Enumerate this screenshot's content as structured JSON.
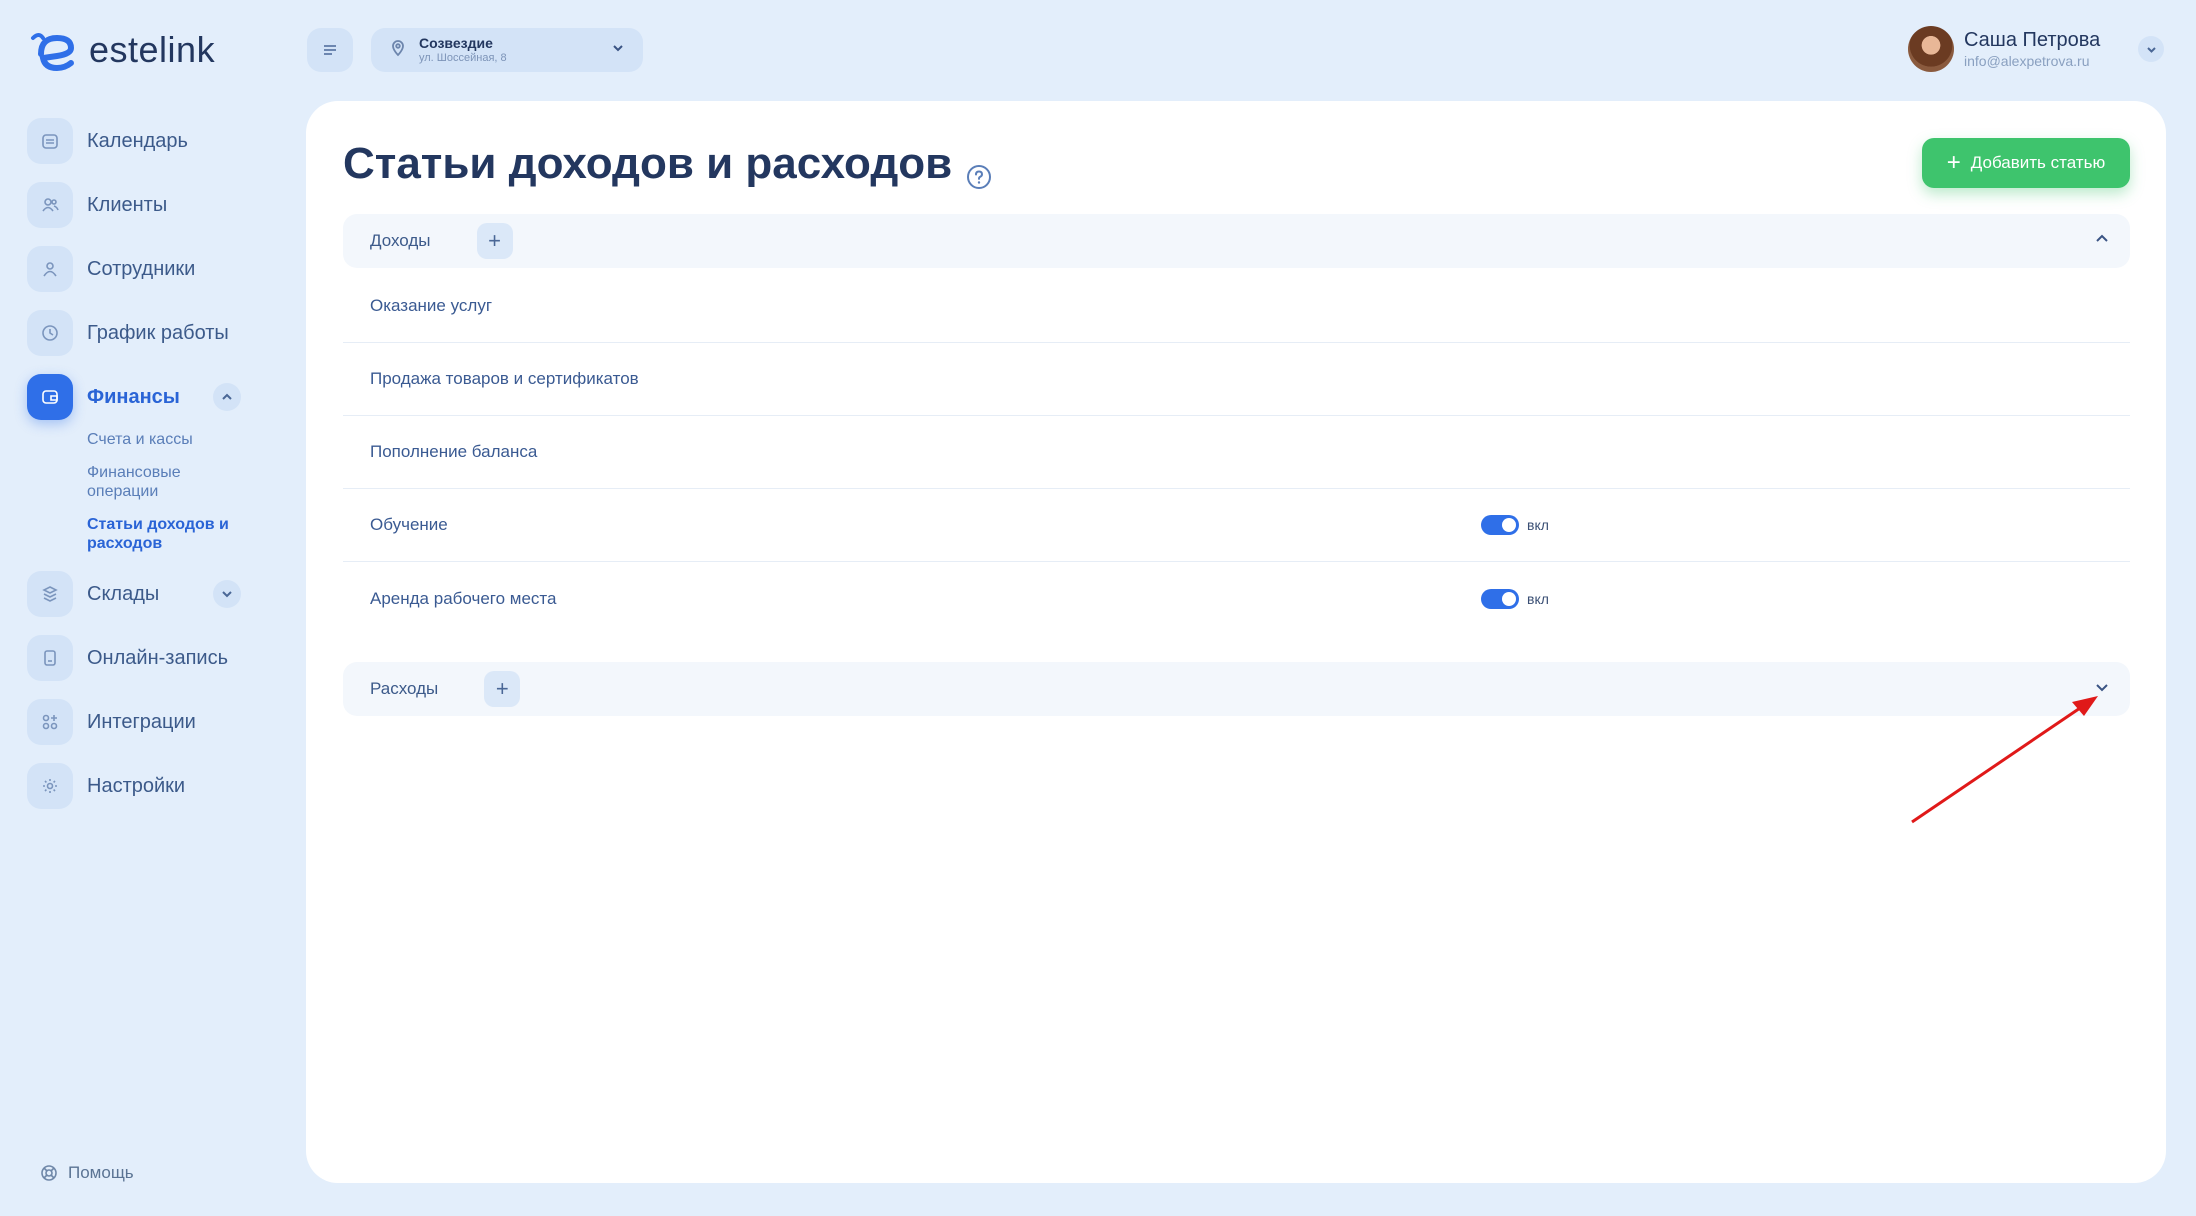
{
  "app": {
    "logo_text": "estelink"
  },
  "sidebar": {
    "items": [
      {
        "label": "Календарь",
        "icon": "calendar-icon"
      },
      {
        "label": "Клиенты",
        "icon": "clients-icon"
      },
      {
        "label": "Сотрудники",
        "icon": "employee-icon"
      },
      {
        "label": "График работы",
        "icon": "clock-icon"
      },
      {
        "label": "Финансы",
        "icon": "wallet-icon",
        "active": true
      },
      {
        "label": "Склады",
        "icon": "warehouse-icon"
      },
      {
        "label": "Онлайн-запись",
        "icon": "phone-icon"
      },
      {
        "label": "Интеграции",
        "icon": "integrations-icon"
      },
      {
        "label": "Настройки",
        "icon": "gear-icon"
      }
    ],
    "finance_sub": [
      {
        "label": "Счета и кассы"
      },
      {
        "label": "Финансовые операции"
      },
      {
        "label": "Статьи доходов и расходов",
        "active": true
      }
    ],
    "help_label": "Помощь"
  },
  "topbar": {
    "location_name": "Созвездие",
    "location_address": "ул. Шоссейная, 8",
    "user_name": "Саша Петрова",
    "user_email": "info@alexpetrova.ru"
  },
  "main": {
    "title": "Статьи доходов и расходов",
    "add_button": "Добавить статью",
    "income": {
      "title": "Доходы",
      "expanded": true,
      "rows": [
        {
          "label": "Оказание услуг",
          "toggle": null
        },
        {
          "label": "Продажа товаров и сертификатов",
          "toggle": null
        },
        {
          "label": "Пополнение баланса",
          "toggle": null
        },
        {
          "label": "Обучение",
          "toggle": "вкл"
        },
        {
          "label": "Аренда рабочего места",
          "toggle": "вкл"
        }
      ]
    },
    "expenses": {
      "title": "Расходы",
      "expanded": false
    }
  },
  "colors": {
    "background": "#e3eefb",
    "accent": "#2f6fe8",
    "add_button": "#3ec46d",
    "annotation_arrow": "#e01919"
  }
}
